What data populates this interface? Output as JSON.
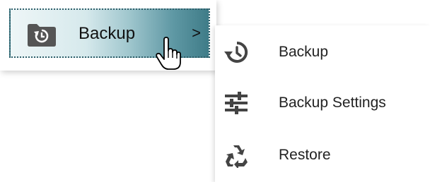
{
  "menu": {
    "item_label": "Backup",
    "chevron": ">",
    "icon": "folder-restore-icon",
    "highlight_colors": [
      "#eef6f7",
      "#3f7c88"
    ]
  },
  "submenu": {
    "items": [
      {
        "label": "Backup",
        "icon": "history-icon"
      },
      {
        "label": "Backup Settings",
        "icon": "sliders-icon"
      },
      {
        "label": "Restore",
        "icon": "recycle-icon"
      }
    ]
  }
}
